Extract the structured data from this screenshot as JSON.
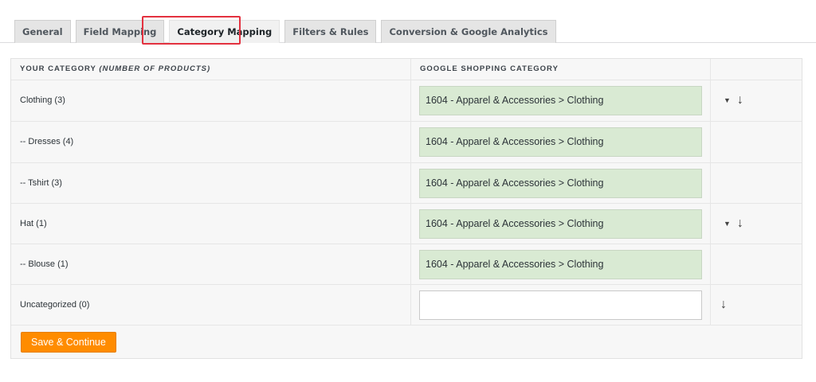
{
  "tabs": [
    {
      "label": "General"
    },
    {
      "label": "Field Mapping"
    },
    {
      "label": "Category Mapping",
      "active": true
    },
    {
      "label": "Filters & Rules"
    },
    {
      "label": "Conversion & Google Analytics"
    }
  ],
  "table": {
    "header": {
      "your_category": "YOUR CATEGORY",
      "your_category_note": "(NUMBER OF PRODUCTS)",
      "google_category": "GOOGLE SHOPPING CATEGORY"
    },
    "rows": [
      {
        "category": "Clothing (3)",
        "google": "1604 - Apparel & Accessories > Clothing",
        "controls": "caret-arrow"
      },
      {
        "category": "-- Dresses (4)",
        "google": "1604 - Apparel & Accessories > Clothing",
        "controls": "none"
      },
      {
        "category": "-- Tshirt (3)",
        "google": "1604 - Apparel & Accessories > Clothing",
        "controls": "none"
      },
      {
        "category": "Hat (1)",
        "google": "1604 - Apparel & Accessories > Clothing",
        "controls": "caret-arrow"
      },
      {
        "category": "-- Blouse (1)",
        "google": "1604 - Apparel & Accessories > Clothing",
        "controls": "none"
      },
      {
        "category": "Uncategorized (0)",
        "google": "",
        "controls": "arrow"
      }
    ]
  },
  "save_button": "Save & Continue",
  "colors": {
    "accent": "#ff8c00",
    "mapped_bg": "#d9ead3",
    "highlight": "#e3313f"
  },
  "icons": {
    "caret": "caret-down-icon",
    "arrow": "arrow-down-icon"
  }
}
